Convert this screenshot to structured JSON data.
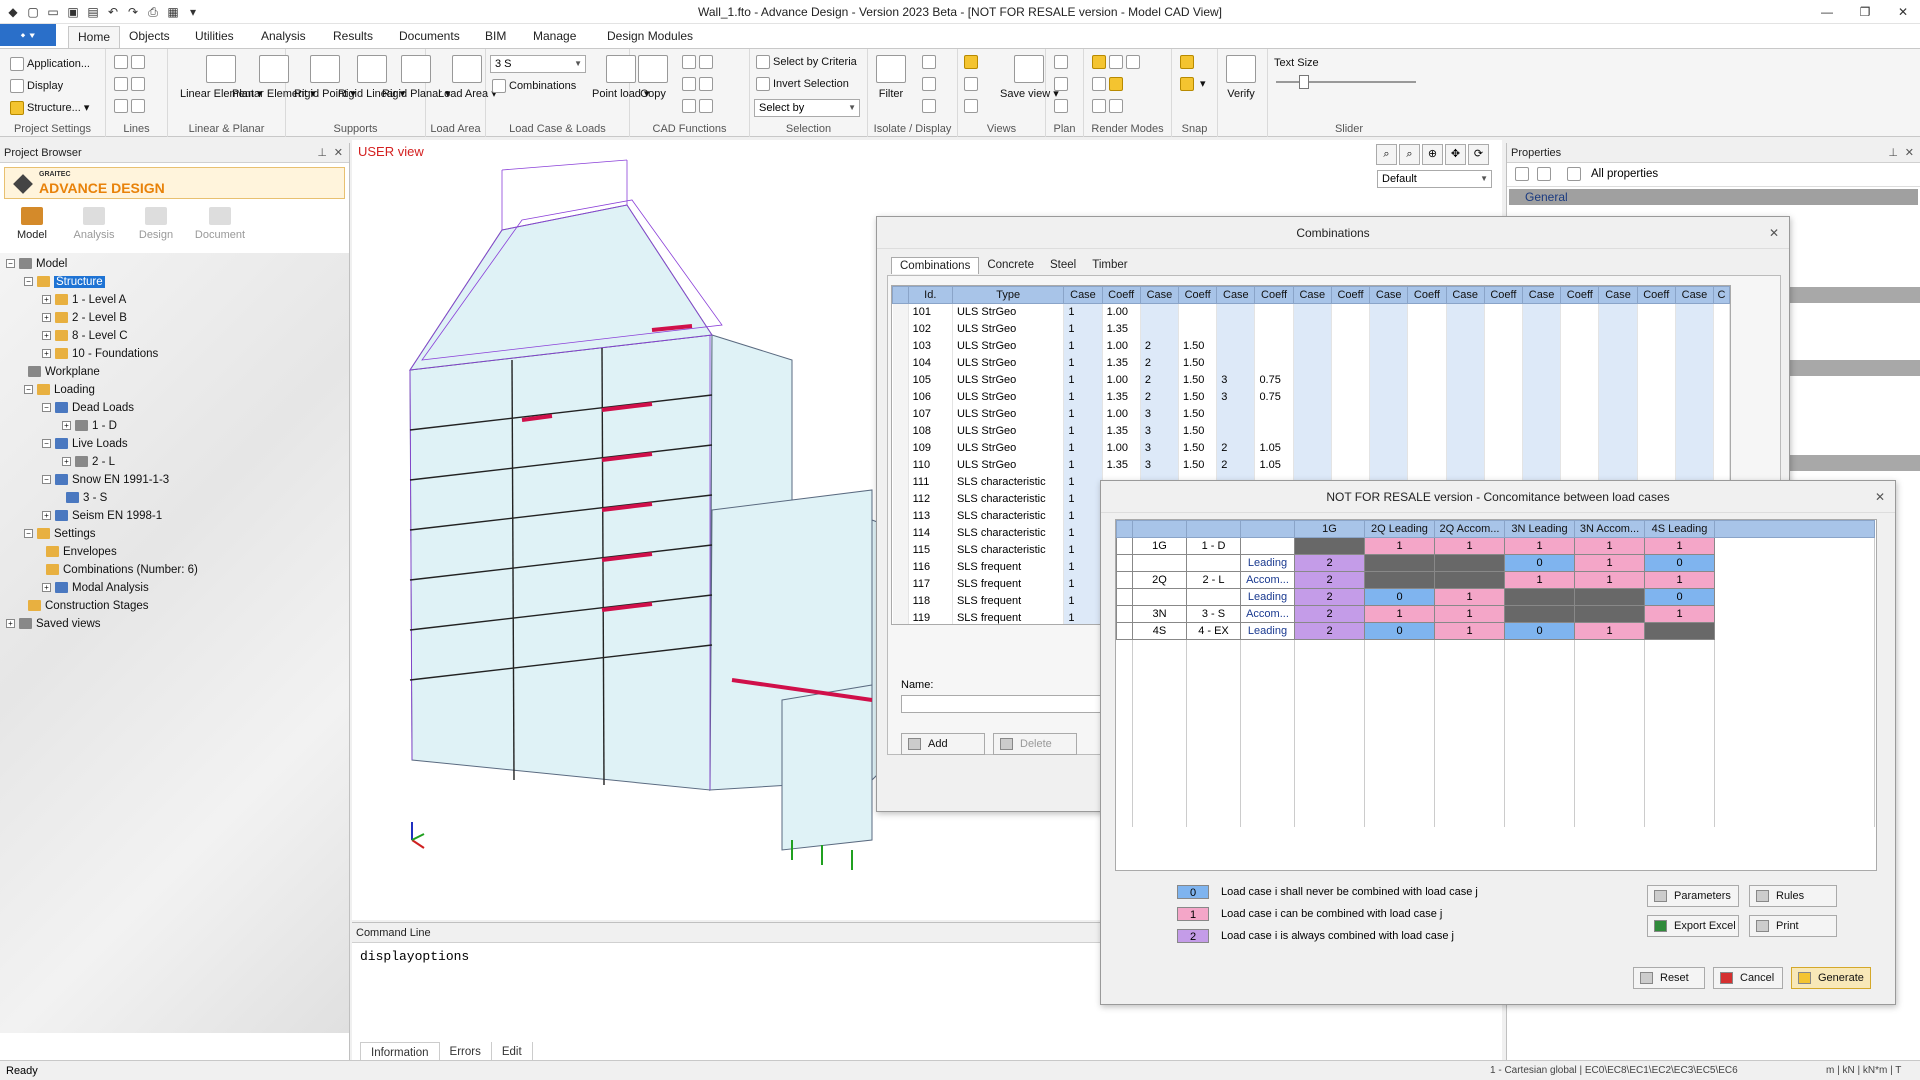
{
  "window": {
    "title": "Wall_1.fto - Advance Design - Version 2023 Beta - [NOT FOR RESALE version - Model CAD View]"
  },
  "ribbon": {
    "app_menu": "⬩",
    "tabs": [
      "Home",
      "Objects",
      "Utilities",
      "Analysis",
      "Results",
      "Documents",
      "BIM",
      "Manage",
      "Design Modules"
    ],
    "project_settings": {
      "items": [
        "Application...",
        "Display",
        "Structure..."
      ],
      "label": "Project Settings"
    },
    "lines": {
      "label": "Lines"
    },
    "linear_planar": {
      "buttons": [
        "Linear Element",
        "Planar Element"
      ],
      "label": "Linear & Planar"
    },
    "supports": {
      "buttons": [
        "Rigid Point",
        "Rigid Linear",
        "Rigid Planar"
      ],
      "label": "Supports"
    },
    "load_area": {
      "button": "Load Area",
      "label": "Load Area"
    },
    "load_case": {
      "combo": "3 S",
      "combinations": "Combinations",
      "point_load": "Point load",
      "label": "Load Case & Loads"
    },
    "cad_functions": {
      "copy": "Copy",
      "label": "CAD Functions"
    },
    "selection": {
      "criteria": "Select by Criteria",
      "invert": "Invert Selection",
      "select_by": "Select by",
      "label": "Selection"
    },
    "isolate": {
      "filter": "Filter",
      "label": "Isolate / Display"
    },
    "views": {
      "save_view": "Save view",
      "label": "Views"
    },
    "plan": {
      "label": "Plan"
    },
    "render_modes": {
      "label": "Render Modes"
    },
    "snap": {
      "label": "Snap"
    },
    "verify": {
      "button": "Verify"
    },
    "slider": {
      "text_size": "Text Size",
      "label": "Slider",
      "value": 0.2
    }
  },
  "project_browser": {
    "title": "Project Browser",
    "logo_small": "GRAITEC",
    "logo_big": "ADVANCE DESIGN",
    "tabs": [
      "Model",
      "Analysis",
      "Design",
      "Document"
    ],
    "tree": {
      "model": "Model",
      "structure": "Structure",
      "level_a": "1 - Level A",
      "level_b": "2 - Level B",
      "level_c": "8 - Level C",
      "foundations": "10 - Foundations",
      "workplane": "Workplane",
      "loading": "Loading",
      "dead_loads": "Dead Loads",
      "d": "1 - D",
      "live_loads": "Live Loads",
      "l": "2 - L",
      "snow": "Snow EN 1991-1-3",
      "s": "3 - S",
      "seism": "Seism EN 1998-1",
      "settings": "Settings",
      "envelopes": "Envelopes",
      "combinations": "Combinations (Number: 6)",
      "modal": "Modal Analysis",
      "stages": "Construction Stages",
      "saved_views": "Saved views"
    }
  },
  "view": {
    "label": "USER view",
    "combo": "Default"
  },
  "command_line": {
    "title": "Command Line",
    "text": "displayoptions",
    "tabs": [
      "Information",
      "Errors",
      "Edit"
    ]
  },
  "properties": {
    "title": "Properties",
    "filter": "All properties",
    "general": "General"
  },
  "combinations_dialog": {
    "title": "Combinations",
    "tabs": [
      "Concrete",
      "Steel",
      "Timber"
    ],
    "active_tab": "Combinations",
    "headers": [
      "Id.",
      "Type",
      "Case",
      "Coeff",
      "Case",
      "Coeff",
      "Case",
      "Coeff",
      "Case",
      "Coeff",
      "Case",
      "Coeff",
      "Case",
      "Coeff",
      "Case",
      "Coeff",
      "Case",
      "Coeff",
      "Case",
      "C"
    ],
    "rows": [
      [
        "101",
        "ULS StrGeo",
        "1",
        "1.00",
        "",
        "",
        "",
        ""
      ],
      [
        "102",
        "ULS StrGeo",
        "1",
        "1.35",
        "",
        "",
        "",
        ""
      ],
      [
        "103",
        "ULS StrGeo",
        "1",
        "1.00",
        "2",
        "1.50",
        "",
        ""
      ],
      [
        "104",
        "ULS StrGeo",
        "1",
        "1.35",
        "2",
        "1.50",
        "",
        ""
      ],
      [
        "105",
        "ULS StrGeo",
        "1",
        "1.00",
        "2",
        "1.50",
        "3",
        "0.75"
      ],
      [
        "106",
        "ULS StrGeo",
        "1",
        "1.35",
        "2",
        "1.50",
        "3",
        "0.75"
      ],
      [
        "107",
        "ULS StrGeo",
        "1",
        "1.00",
        "3",
        "1.50",
        "",
        ""
      ],
      [
        "108",
        "ULS StrGeo",
        "1",
        "1.35",
        "3",
        "1.50",
        "",
        ""
      ],
      [
        "109",
        "ULS StrGeo",
        "1",
        "1.00",
        "3",
        "1.50",
        "2",
        "1.05"
      ],
      [
        "110",
        "ULS StrGeo",
        "1",
        "1.35",
        "3",
        "1.50",
        "2",
        "1.05"
      ],
      [
        "111",
        "SLS characteristic",
        "1",
        "",
        "",
        "",
        "",
        ""
      ],
      [
        "112",
        "SLS characteristic",
        "1",
        "",
        "",
        "",
        "",
        ""
      ],
      [
        "113",
        "SLS characteristic",
        "1",
        "",
        "",
        "",
        "",
        ""
      ],
      [
        "114",
        "SLS characteristic",
        "1",
        "",
        "",
        "",
        "",
        ""
      ],
      [
        "115",
        "SLS characteristic",
        "1",
        "",
        "",
        "",
        "",
        ""
      ],
      [
        "116",
        "SLS frequent",
        "1",
        "",
        "",
        "",
        "",
        ""
      ],
      [
        "117",
        "SLS frequent",
        "1",
        "",
        "",
        "",
        "",
        ""
      ],
      [
        "118",
        "SLS frequent",
        "1",
        "",
        "",
        "",
        "",
        ""
      ],
      [
        "119",
        "SLS frequent",
        "1",
        "",
        "",
        "",
        "",
        ""
      ]
    ],
    "name_label": "Name:",
    "add": "Add",
    "delete": "Delete"
  },
  "concomitance_dialog": {
    "title": "NOT FOR RESALE version - Concomitance between load cases",
    "col_headers": [
      "1G",
      "2Q Leading",
      "2Q Accom...",
      "3N Leading",
      "3N Accom...",
      "4S Leading"
    ],
    "rows": [
      {
        "code": "1G",
        "case": "1 - D",
        "role": "",
        "cells": [
          "g",
          "1",
          "1",
          "1",
          "1",
          "1"
        ]
      },
      {
        "code": "",
        "case": "",
        "role": "Leading",
        "cells": [
          "2",
          "g",
          "g",
          "0",
          "1",
          "0"
        ]
      },
      {
        "code": "2Q",
        "case": "2 - L",
        "role": "Accom...",
        "cells": [
          "2",
          "g",
          "g",
          "1",
          "1",
          "1"
        ]
      },
      {
        "code": "",
        "case": "",
        "role": "Leading",
        "cells": [
          "2",
          "0",
          "1",
          "g",
          "g",
          "0"
        ]
      },
      {
        "code": "3N",
        "case": "3 - S",
        "role": "Accom...",
        "cells": [
          "2",
          "1",
          "1",
          "g",
          "g",
          "1"
        ]
      },
      {
        "code": "4S",
        "case": "4 - EX",
        "role": "Leading",
        "cells": [
          "2",
          "0",
          "1",
          "0",
          "1",
          "g"
        ]
      }
    ],
    "legend": [
      {
        "value": "0",
        "text": "Load case i shall never be combined with load case j"
      },
      {
        "value": "1",
        "text": "Load case i can be combined with load case j"
      },
      {
        "value": "2",
        "text": "Load case i is always combined with load case j"
      }
    ],
    "buttons": {
      "parameters": "Parameters",
      "rules": "Rules",
      "export": "Export Excel",
      "print": "Print",
      "reset": "Reset",
      "cancel": "Cancel",
      "generate": "Generate"
    },
    "colors": {
      "0": "#7fb4ef",
      "1": "#f4a6c8",
      "2": "#c49ce8",
      "g": "#686868"
    }
  },
  "status": {
    "ready": "Ready",
    "coord": "1 - Cartesian global",
    "codes": "EC0\\EC8\\EC1\\EC2\\EC3\\EC5\\EC6",
    "units": "m | kN | kN*m | T"
  }
}
